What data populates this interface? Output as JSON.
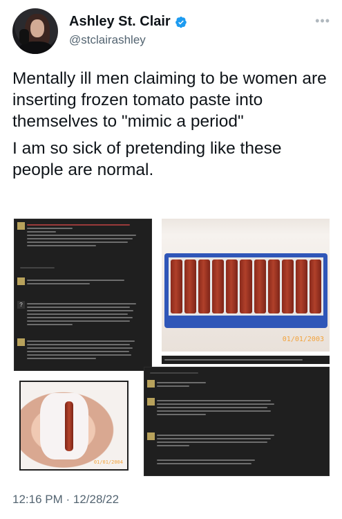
{
  "author": {
    "display_name": "Ashley St. Clair",
    "handle": "@stclairashley",
    "verified": true,
    "verified_color": "#1d9bf0"
  },
  "more_icon": "more-horizontal-icon",
  "tweet": {
    "paragraphs": [
      "Mentally ill men claiming to be women are inserting frozen tomato paste into themselves to \"mimic a period\"",
      "I am so sick of pretending like these people are normal."
    ]
  },
  "media": {
    "photo_tomatoes_date": "01/01/2003",
    "photo_hand_date": "01/01/2004"
  },
  "timestamp": "12:16 PM · 12/28/22",
  "colors": {
    "text_primary": "#0f1419",
    "text_secondary": "#536471",
    "screenshot_bg": "#1f1f1f",
    "date_stamp": "#f2a23a"
  }
}
